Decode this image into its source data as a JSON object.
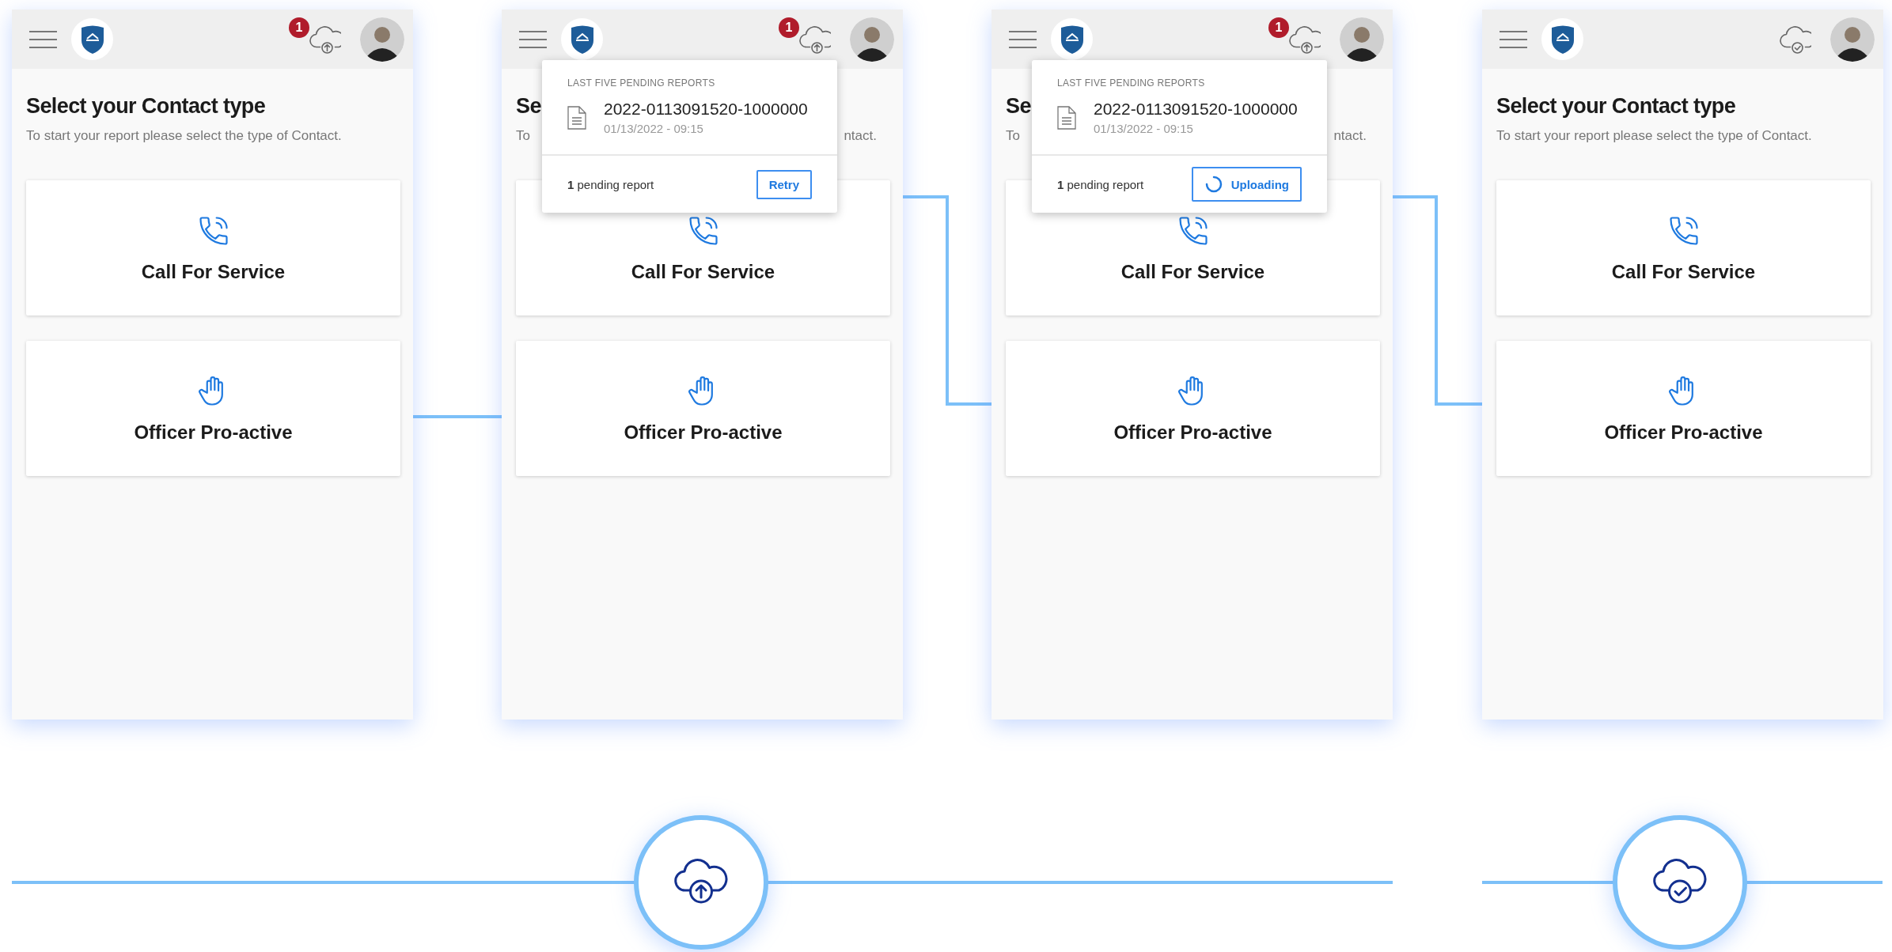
{
  "screens": [
    {
      "header": {
        "synced": false,
        "badge": "1"
      },
      "title": "Select your Contact type",
      "subtitle": [
        "To start your report please select the type of Contact."
      ],
      "cards": [
        {
          "kind": "phone",
          "label": "Call For Service"
        },
        {
          "kind": "hand",
          "label": "Officer Pro-active"
        }
      ]
    },
    {
      "header": {
        "synced": false,
        "badge": "1"
      },
      "title": "Se",
      "subtitle": [
        "To",
        "ntact."
      ],
      "cards": [
        {
          "kind": "phone",
          "label": "Call For Service"
        },
        {
          "kind": "hand",
          "label": "Officer Pro-active"
        }
      ],
      "popup": {
        "heading": "LAST FIVE PENDING REPORTS",
        "reports": [
          {
            "id": "2022-0113091520-1000000",
            "date": "01/13/2022 - 09:15"
          }
        ],
        "pending": "**1** pending report",
        "action": {
          "kind": "retry",
          "label": "Retry"
        }
      }
    },
    {
      "header": {
        "synced": false,
        "badge": "1"
      },
      "title": "Se",
      "subtitle": [
        "To",
        "ntact."
      ],
      "cards": [
        {
          "kind": "phone",
          "label": "Call For Service"
        },
        {
          "kind": "hand",
          "label": "Officer Pro-active"
        }
      ],
      "popup": {
        "heading": "LAST FIVE PENDING REPORTS",
        "reports": [
          {
            "id": "2022-0113091520-1000000",
            "date": "01/13/2022 - 09:15"
          }
        ],
        "pending": "**1** pending report",
        "action": {
          "kind": "uploading",
          "label": "Uploading"
        }
      }
    },
    {
      "header": {
        "synced": true
      },
      "title": "Select your Contact type",
      "subtitle": [
        "To start your report please select the type of Contact."
      ],
      "cards": [
        {
          "kind": "phone",
          "label": "Call For Service"
        },
        {
          "kind": "hand",
          "label": "Officer Pro-active"
        }
      ]
    }
  ],
  "markers": [
    {
      "kind": "upload"
    },
    {
      "kind": "done"
    }
  ]
}
